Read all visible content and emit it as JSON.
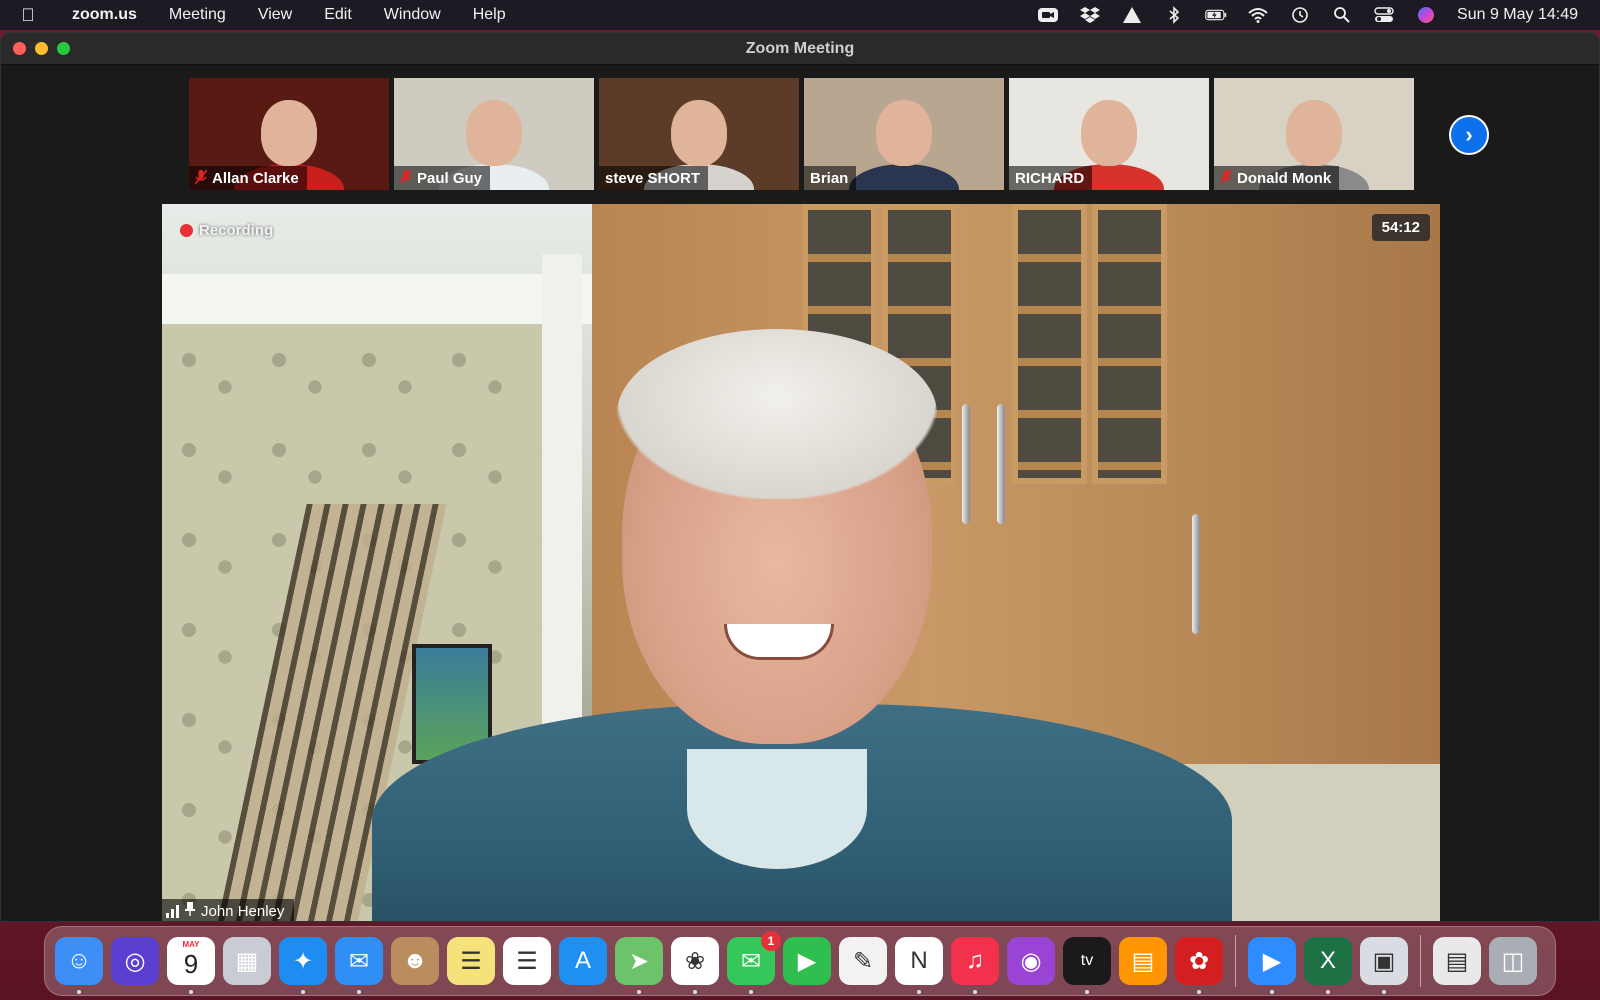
{
  "menubar": {
    "app_name": "zoom.us",
    "menus": [
      "Meeting",
      "View",
      "Edit",
      "Window",
      "Help"
    ],
    "clock": "Sun 9 May  14:49"
  },
  "window": {
    "title": "Zoom Meeting"
  },
  "participants": [
    {
      "name": "Allan Clarke",
      "muted": true,
      "bg": "#5a1a14",
      "shirt": "#c8201e"
    },
    {
      "name": "Paul Guy",
      "muted": true,
      "bg": "#cfcbc0",
      "shirt": "#e9eef2"
    },
    {
      "name": "steve SHORT",
      "muted": false,
      "bg": "#5c3b28",
      "shirt": "#d6d3cf"
    },
    {
      "name": "Brian",
      "muted": false,
      "bg": "#b8a690",
      "shirt": "#2a3550"
    },
    {
      "name": "RICHARD",
      "muted": false,
      "bg": "#e8e6e0",
      "shirt": "#d8322c"
    },
    {
      "name": "Donald Monk",
      "muted": true,
      "bg": "#d8d2c4",
      "shirt": "#8a8a8a"
    }
  ],
  "main_video": {
    "recording_label": "Recording",
    "timer": "54:12",
    "speaker_name": "John Henley"
  },
  "dock": {
    "calendar_month": "MAY",
    "calendar_day": "9",
    "messages_badge": "1",
    "apps": [
      {
        "name": "finder-icon",
        "color": "#3e8ef7"
      },
      {
        "name": "siri-icon",
        "color": "#5b3fd0"
      },
      {
        "name": "calendar-icon",
        "color": "#ffffff"
      },
      {
        "name": "launchpad-icon",
        "color": "#c9ccd4"
      },
      {
        "name": "safari-icon",
        "color": "#1e8cf0"
      },
      {
        "name": "mail-icon",
        "color": "#2f8ff5"
      },
      {
        "name": "contacts-icon",
        "color": "#b98d5e"
      },
      {
        "name": "notes-icon",
        "color": "#f6e27a"
      },
      {
        "name": "reminders-icon",
        "color": "#ffffff"
      },
      {
        "name": "app-store-icon",
        "color": "#1f8ff2"
      },
      {
        "name": "maps-icon",
        "color": "#6cc36a"
      },
      {
        "name": "photos-icon",
        "color": "#ffffff"
      },
      {
        "name": "messages-icon",
        "color": "#35c759"
      },
      {
        "name": "facetime-icon",
        "color": "#2fbf4f"
      },
      {
        "name": "script-editor-icon",
        "color": "#f2f2f2"
      },
      {
        "name": "news-icon",
        "color": "#ffffff"
      },
      {
        "name": "music-icon",
        "color": "#f3314c"
      },
      {
        "name": "podcasts-icon",
        "color": "#9a44d6"
      },
      {
        "name": "apple-tv-icon",
        "color": "#1a1a1a"
      },
      {
        "name": "books-icon",
        "color": "#ff9500"
      },
      {
        "name": "acrobat-icon",
        "color": "#d31f1f"
      },
      {
        "name": "zoom-icon",
        "color": "#2d8cff"
      },
      {
        "name": "excel-icon",
        "color": "#1e7145"
      },
      {
        "name": "preview-icon",
        "color": "#d9dde3"
      },
      {
        "name": "documents-stack-icon",
        "color": "#e9e9e9"
      },
      {
        "name": "trash-icon",
        "color": "#a9adb4"
      }
    ]
  }
}
